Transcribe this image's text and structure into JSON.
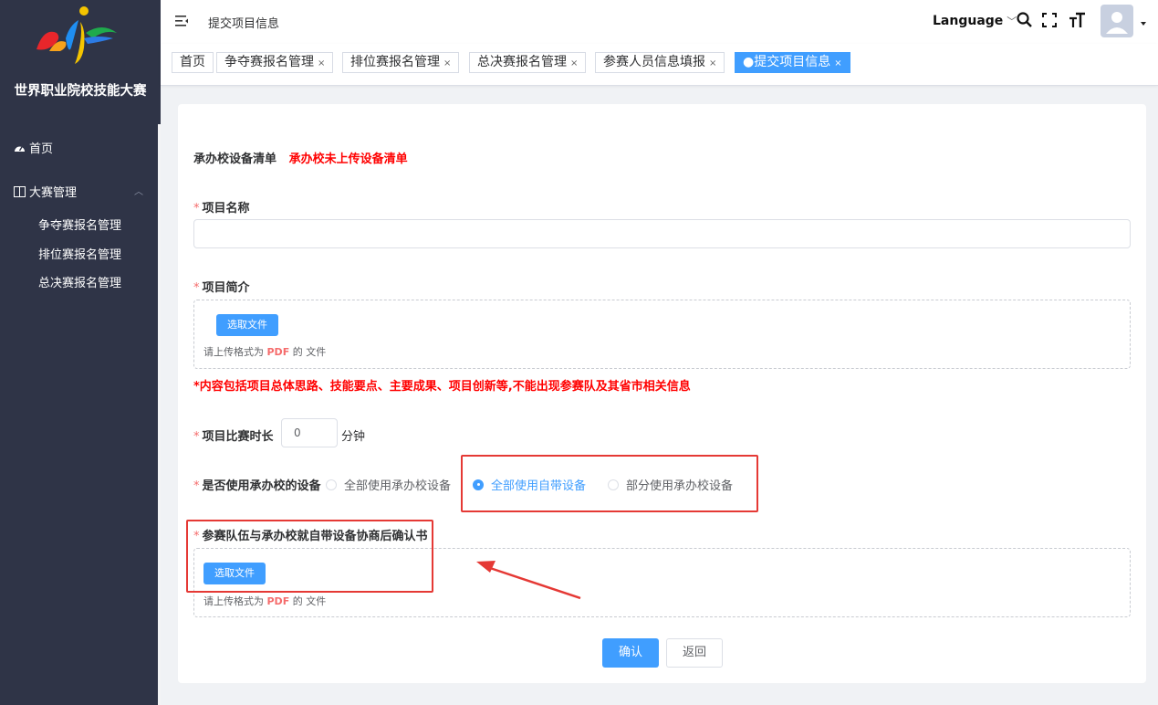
{
  "sidebar": {
    "site_title": "世界职业院校技能大赛",
    "home": "首页",
    "group": "大赛管理",
    "items": [
      {
        "label": "争夺赛报名管理"
      },
      {
        "label": "排位赛报名管理"
      },
      {
        "label": "总决赛报名管理"
      }
    ]
  },
  "topbar": {
    "breadcrumb": "提交项目信息",
    "language": "Language"
  },
  "tabs": [
    {
      "label": "首页",
      "close": ""
    },
    {
      "label": "争夺赛报名管理",
      "close": "×"
    },
    {
      "label": "排位赛报名管理",
      "close": "×"
    },
    {
      "label": "总决赛报名管理",
      "close": "×"
    },
    {
      "label": "参赛人员信息填报",
      "close": "×"
    },
    {
      "label": "●提交项目信息",
      "close": "×"
    }
  ],
  "form": {
    "equipment_list_label": "承办校设备清单",
    "equipment_list_note": "承办校未上传设备清单",
    "req_mark": "*",
    "project_name_label": "项目名称",
    "project_name_value": "",
    "intro_label": "项目简介",
    "choose_file": "选取文件",
    "tip_prefix": "请上传格式为",
    "tip_format": "PDF",
    "tip_suffix": "的 文件",
    "intro_warning": "*内容包括项目总体思路、技能要点、主要成果、项目创新等,不能出现参赛队及其省市相关信息",
    "duration_label": "项目比赛时长",
    "duration_value": "0",
    "duration_unit": "分钟",
    "equipment_label": "是否使用承办校的设备",
    "radio_options": [
      "全部使用承办校设备",
      "全部使用自带设备",
      "部分使用承办校设备"
    ],
    "radio_selected": "全部使用自带设备",
    "confirmation_label": "参赛队伍与承办校就自带设备协商后确认书",
    "confirm_button": "确认",
    "back_button": "返回"
  },
  "colors": {
    "sidebar_bg": "#2f3447",
    "primary": "#409eff",
    "warning_red": "#ff0000",
    "annotation_red": "#e53935"
  }
}
